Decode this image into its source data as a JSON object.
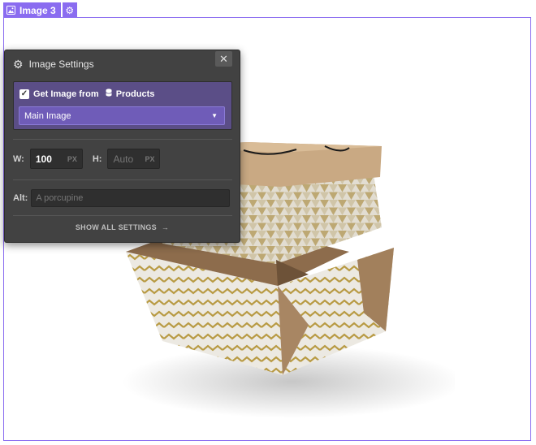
{
  "element_tag": {
    "label": "Image 3",
    "icon": "image-icon",
    "settings_icon": "gear-icon",
    "color": "#8a6cf0"
  },
  "panel": {
    "title": "Image Settings",
    "title_icon": "gear-icon",
    "close_icon": "close-icon",
    "get_image": {
      "checked": true,
      "label": "Get Image from",
      "source_icon": "database-icon",
      "source": "Products"
    },
    "field_select": {
      "value": "Main Image",
      "accent": "#6f5cb8"
    },
    "width": {
      "label": "W:",
      "value": "100",
      "unit": "PX"
    },
    "height": {
      "label": "H:",
      "placeholder": "Auto",
      "unit": "PX"
    },
    "alt": {
      "label": "Alt:",
      "placeholder": "A porcupine"
    },
    "show_all": "SHOW ALL SETTINGS"
  },
  "canvas_image": {
    "subject": "food-box-product-image"
  }
}
